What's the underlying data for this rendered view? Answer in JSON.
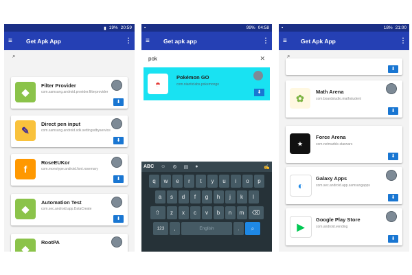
{
  "colors": {
    "appbar": "#2540b4",
    "statusbar": "#1a2f86",
    "highlight": "#19e2f2",
    "keyboard": "#263238",
    "key": "#455a64"
  },
  "screens": [
    {
      "status": {
        "battery": "19%",
        "time": "20:59"
      },
      "app_title": "Get Apk App",
      "search_placeholder": "",
      "apps": [
        {
          "name": "Filter Provider",
          "package": "com.samsung.android.provider.filterprovider",
          "icon": "android-icon"
        },
        {
          "name": "Direct pen input",
          "package": "com.samsung.android.sdk.settingsdbyservice",
          "icon": "pen-icon"
        },
        {
          "name": "RoseEUKor",
          "package": "com.monotype.android.font.rosemary",
          "icon": "font-icon"
        },
        {
          "name": "Automation Test",
          "package": "com.sec.android.app.DataCreate",
          "icon": "android-icon"
        },
        {
          "name": "RootPA",
          "package": "",
          "icon": "android-icon"
        }
      ]
    },
    {
      "status": {
        "battery": "99%",
        "time": "04:58"
      },
      "app_title": "Get apk app",
      "search_value": "pok",
      "result": {
        "name": "Pokémon GO",
        "package": "com.nianticlabs.pokemongo",
        "icon": "pokeball-icon"
      },
      "keyboard": {
        "mode": "ABC",
        "row1": [
          "q",
          "w",
          "e",
          "r",
          "t",
          "y",
          "u",
          "i",
          "o",
          "p"
        ],
        "row2": [
          "a",
          "s",
          "d",
          "f",
          "g",
          "h",
          "j",
          "k",
          "l"
        ],
        "row3": [
          "z",
          "x",
          "c",
          "v",
          "b",
          "n",
          "m"
        ],
        "numbers_key": "123",
        "space_label": "English"
      }
    },
    {
      "status": {
        "battery": "18%",
        "time": "21:00"
      },
      "app_title": "Get Apk App",
      "apps": [
        {
          "name": "Math Arena",
          "package": "com.boardstudio.mathstudent",
          "icon": "math-icon"
        },
        {
          "name": "Force Arena",
          "package": "com.netmarble.starwars",
          "icon": "starwars-icon"
        },
        {
          "name": "Galaxy Apps",
          "package": "com.sec.android.app.samsungapps",
          "icon": "galaxy-icon"
        },
        {
          "name": "Google Play Store",
          "package": "com.android.vending",
          "icon": "play-icon"
        }
      ]
    }
  ]
}
